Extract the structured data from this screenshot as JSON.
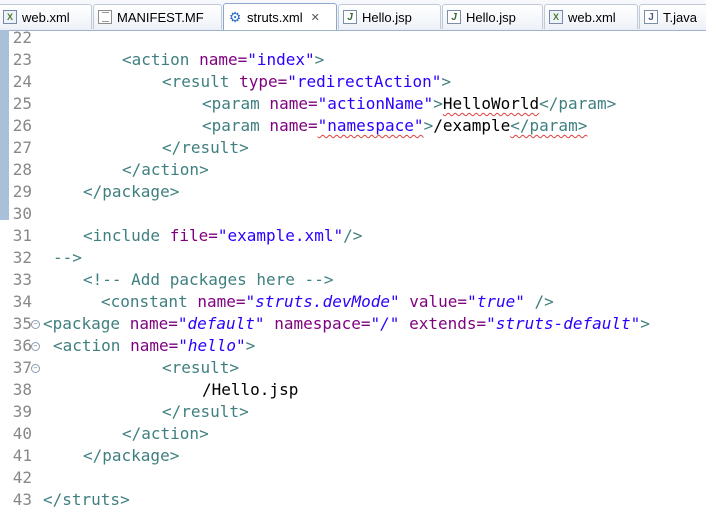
{
  "tabs": [
    {
      "label": "web.xml",
      "icon": "xml-file-icon"
    },
    {
      "label": "MANIFEST.MF",
      "icon": "text-file-icon"
    },
    {
      "label": "struts.xml",
      "icon": "gear-icon",
      "active": true
    },
    {
      "label": "Hello.jsp",
      "icon": "jsp-file-icon"
    },
    {
      "label": "Hello.jsp",
      "icon": "jsp-file-icon"
    },
    {
      "label": "web.xml",
      "icon": "xml-file-icon"
    },
    {
      "label": "T.java",
      "icon": "java-file-icon"
    }
  ],
  "close_glyph": "✕",
  "editor": {
    "lines": [
      {
        "n": "22"
      },
      {
        "n": "23",
        "s1": "<action",
        "s2": " name=",
        "s3": "\"index\"",
        "s4": ">"
      },
      {
        "n": "24",
        "s1": "<result",
        "s2": " type=",
        "s3": "\"redirectAction\"",
        "s4": ">"
      },
      {
        "n": "25",
        "s1": "<param",
        "s2": " name=",
        "s3": "\"actionName\"",
        "s4": ">",
        "s5": "HelloWorld",
        "s6": "</param>"
      },
      {
        "n": "26",
        "s1": "<param",
        "s2": " name=",
        "s3": "\"namespace\"",
        "s4": ">",
        "s5": "/example",
        "s6": "</param>"
      },
      {
        "n": "27",
        "s1": "</result>"
      },
      {
        "n": "28",
        "s1": "</action>"
      },
      {
        "n": "29",
        "s1": "</package>"
      },
      {
        "n": "30"
      },
      {
        "n": "31",
        "s1": "<include",
        "s2": " file=",
        "s3": "\"example.xml\"",
        "s4": "/>"
      },
      {
        "n": "32",
        "s1": "-->"
      },
      {
        "n": "33",
        "s1": "<!-- Add packages here -->"
      },
      {
        "n": "34",
        "s1": "<constant",
        "s2": " name=",
        "s3": "\"struts.devMode\"",
        "s4": " value=",
        "s5": "\"true\"",
        "s6": " />"
      },
      {
        "n": "35",
        "s1": "<package",
        "s2": " name=",
        "s3": "\"default\"",
        "s4": " namespace=",
        "s5": "\"/\"",
        "s6": " extends=",
        "s7": "\"struts-default\"",
        "s8": ">"
      },
      {
        "n": "36",
        "s1": "<action",
        "s2": " name=",
        "s3": "\"hello\"",
        "s4": ">"
      },
      {
        "n": "37",
        "s1": "<result>"
      },
      {
        "n": "38",
        "s1": "/Hello.jsp"
      },
      {
        "n": "39",
        "s1": "</result>"
      },
      {
        "n": "40",
        "s1": "</action>"
      },
      {
        "n": "41",
        "s1": "</package>"
      },
      {
        "n": "42"
      },
      {
        "n": "43",
        "s1": "</struts>"
      }
    ]
  }
}
